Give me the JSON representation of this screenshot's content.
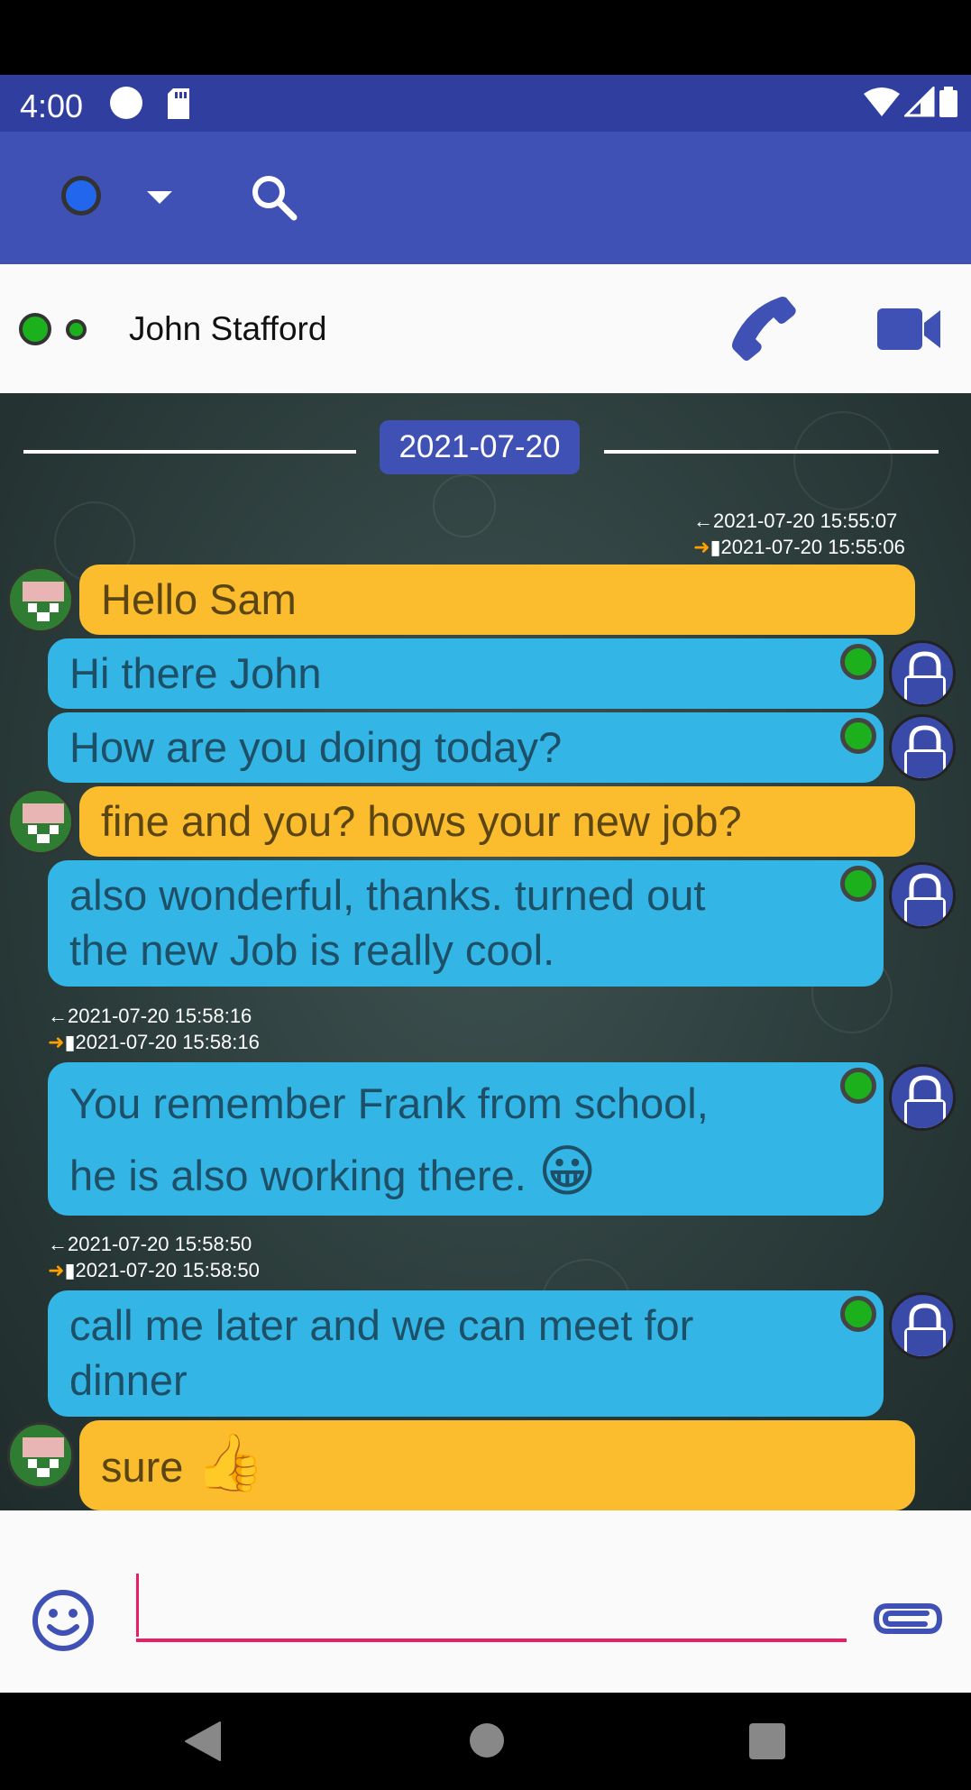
{
  "status_bar": {
    "time": "4:00"
  },
  "toolbar": {
    "presence_icon": "presence-dot",
    "dropdown_icon": "dropdown-arrow-icon",
    "search_icon": "search-icon"
  },
  "contact": {
    "name": "John Stafford"
  },
  "chat": {
    "date_separator": "2021-07-20",
    "messages": [
      {
        "direction": "in",
        "text": "Hello Sam",
        "ts_left": "2021-07-20 15:55:07",
        "ts_right": "2021-07-20 15:55:06"
      },
      {
        "direction": "out",
        "text": "Hi there John"
      },
      {
        "direction": "out",
        "text": "How are you doing today?"
      },
      {
        "direction": "in",
        "text": "fine and you? hows your new job?"
      },
      {
        "direction": "out",
        "line1": "also wonderful, thanks. turned out",
        "line2": "the new Job is really cool."
      },
      {
        "direction": "out",
        "line1": "You remember Frank from school,",
        "line2": "he is also working there.",
        "emoji": "😀",
        "ts_left": "2021-07-20 15:58:16",
        "ts_right": "2021-07-20 15:58:16"
      },
      {
        "direction": "out",
        "line1": "call me later and we can meet for",
        "line2": "dinner",
        "ts_left": "2021-07-20 15:58:50",
        "ts_right": "2021-07-20 15:58:50"
      },
      {
        "direction": "in",
        "text": "sure",
        "emoji": "👍"
      }
    ]
  },
  "input": {
    "value": "",
    "placeholder": ""
  },
  "colors": {
    "primary": "#3F51B5",
    "primary_dark": "#303F9F",
    "incoming": "#FBBC2E",
    "outgoing": "#33B5E5",
    "accent": "#E91E63",
    "online": "#1DB01D"
  }
}
